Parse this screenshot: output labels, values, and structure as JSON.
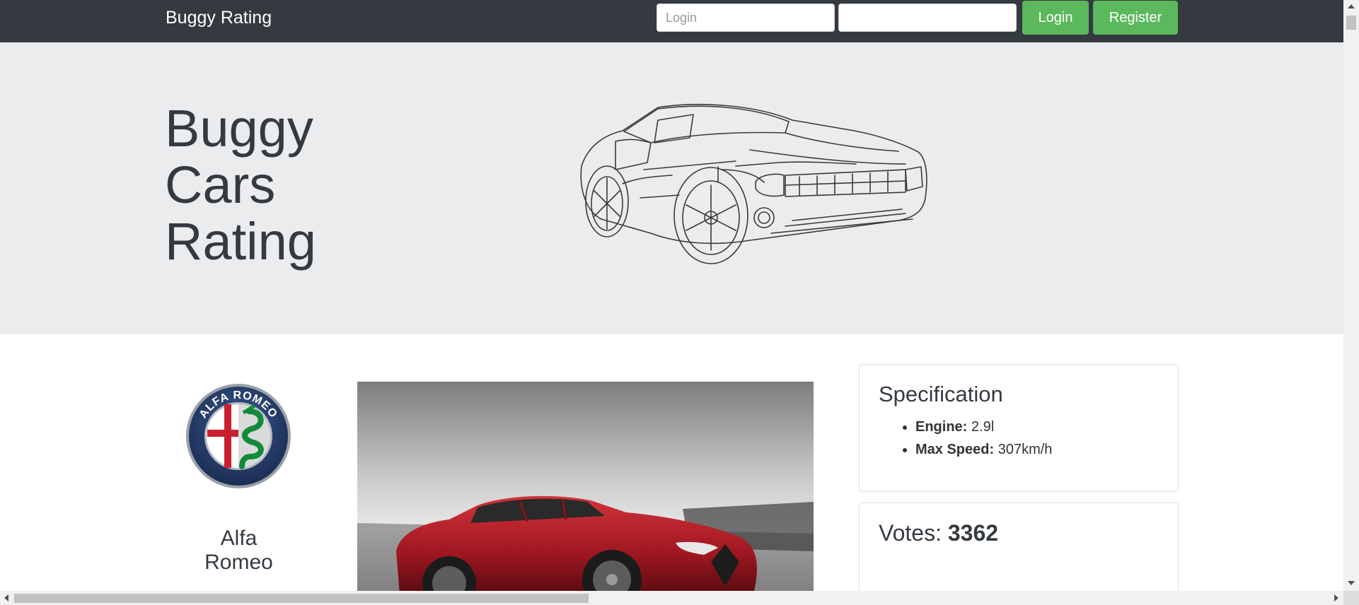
{
  "navbar": {
    "brand": "Buggy Rating",
    "login_placeholder": "Login",
    "password_value": "",
    "login_button": "Login",
    "register_button": "Register",
    "button_color": "#5cb85c",
    "background": "#343a40"
  },
  "hero": {
    "title_lines": [
      "Buggy",
      "Cars",
      "Rating"
    ],
    "background": "#ebecee"
  },
  "model": {
    "make_lines": [
      "Alfa",
      "Romeo"
    ],
    "logo_text": "ALFA ROMEO"
  },
  "specification": {
    "title": "Specification",
    "items": [
      {
        "label": "Engine:",
        "value": "2.9l"
      },
      {
        "label": "Max Speed:",
        "value": "307km/h"
      }
    ]
  },
  "votes": {
    "label": "Votes:",
    "count": "3362"
  }
}
